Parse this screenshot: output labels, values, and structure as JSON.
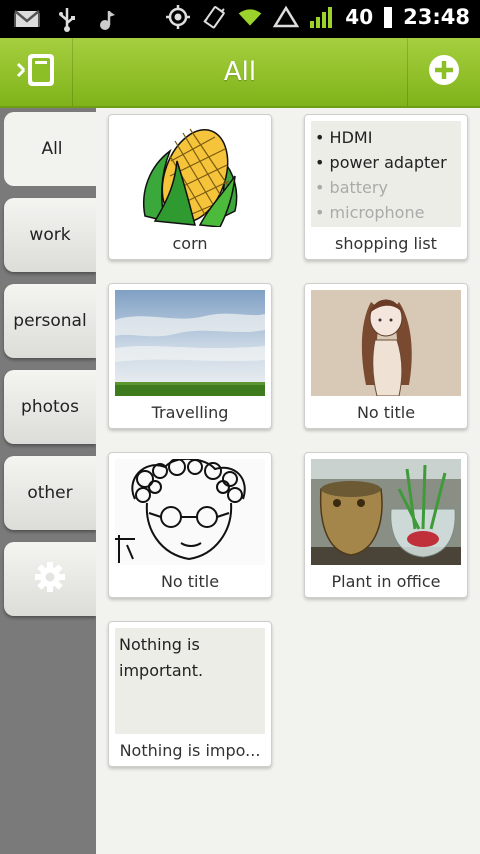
{
  "status_bar": {
    "icons": [
      "gmail-icon",
      "usb-icon",
      "music-icon",
      "gps-icon",
      "vibrate-icon",
      "wifi-icon",
      "no-signal-icon",
      "signal-bars-icon"
    ],
    "battery": "40",
    "time": "23:48"
  },
  "action_bar": {
    "title": "All",
    "left_icon": "notebook-icon",
    "right_icon": "add-icon",
    "accent": "#8cbf26"
  },
  "sidebar": {
    "tabs": [
      {
        "label": "All",
        "active": true
      },
      {
        "label": "work"
      },
      {
        "label": "personal"
      },
      {
        "label": "photos"
      },
      {
        "label": "other"
      }
    ],
    "settings_icon": "gear-icon"
  },
  "notes": [
    {
      "title": "corn",
      "kind": "image",
      "image": "corn drawing"
    },
    {
      "title": "shopping list",
      "kind": "checklist",
      "items": [
        {
          "text": "HDMI",
          "done": false
        },
        {
          "text": "power adapter",
          "done": false
        },
        {
          "text": "battery",
          "done": true
        },
        {
          "text": "microphone",
          "done": true
        }
      ]
    },
    {
      "title": "Travelling",
      "kind": "image",
      "image": "sky over field"
    },
    {
      "title": "No title",
      "kind": "image",
      "image": "girl sketch"
    },
    {
      "title": "No title",
      "kind": "image",
      "image": "curly hair self-portrait"
    },
    {
      "title": "Plant in office",
      "kind": "image",
      "image": "plant in cup"
    },
    {
      "title": "Nothing is impo...",
      "kind": "text",
      "body": "Nothing is important."
    }
  ]
}
